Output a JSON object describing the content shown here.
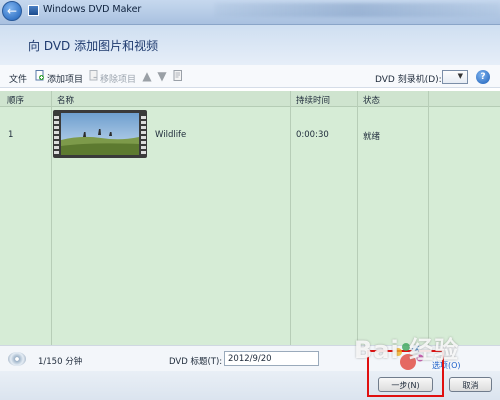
{
  "window": {
    "title": "Windows DVD Maker",
    "heading": "向 DVD 添加图片和视频"
  },
  "toolbar": {
    "file_label": "文件",
    "add_items_label": "添加项目",
    "remove_items_label": "移除项目",
    "drive_label": "DVD 刻录机(D):",
    "help_icon": "?"
  },
  "list": {
    "columns": [
      "顺序",
      "名称",
      "持续时间",
      "状态"
    ],
    "rows": [
      {
        "order": "1",
        "name": "Wildlife",
        "duration": "0:00:30",
        "status": "就绪"
      }
    ]
  },
  "status": {
    "progress_text": "1/150 分钟",
    "dvd_title_label": "DVD 标题(T):",
    "dvd_title_value": "2012/9/20"
  },
  "footer": {
    "options_link": "选项(O)",
    "next_button": "一步(N)",
    "cancel_button": "取消"
  },
  "watermark": "Bai 经验",
  "colors": {
    "list_background": "#d6ecd6",
    "highlight_border": "#e01010",
    "title_bar": "#b9cde6"
  }
}
